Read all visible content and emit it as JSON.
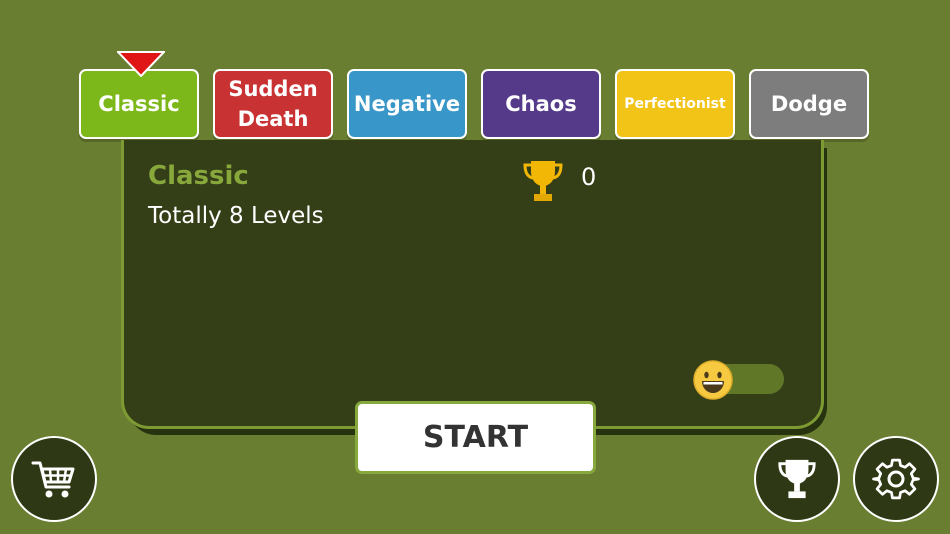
{
  "tabs": [
    {
      "label": "Classic",
      "color": "#7db81a"
    },
    {
      "label": "Sudden\nDeath",
      "color": "#c83232"
    },
    {
      "label": "Negative",
      "color": "#3896c8"
    },
    {
      "label": "Chaos",
      "color": "#553a8a"
    },
    {
      "label": "Perfectionist",
      "color": "#f2c418"
    },
    {
      "label": "Dodge",
      "color": "#7d7d7d"
    }
  ],
  "selected_tab": 0,
  "selector_color": "#e01616",
  "panel": {
    "mode_title": "Classic",
    "mode_description": "Totally 8 Levels",
    "trophy_icon": "trophy-icon",
    "score": "0",
    "toggle_icon": "grinning-face-icon"
  },
  "start_label": "START",
  "bottom_buttons": {
    "shop_icon": "cart-icon",
    "leaderboard_icon": "trophy-icon",
    "settings_icon": "gear-icon"
  }
}
